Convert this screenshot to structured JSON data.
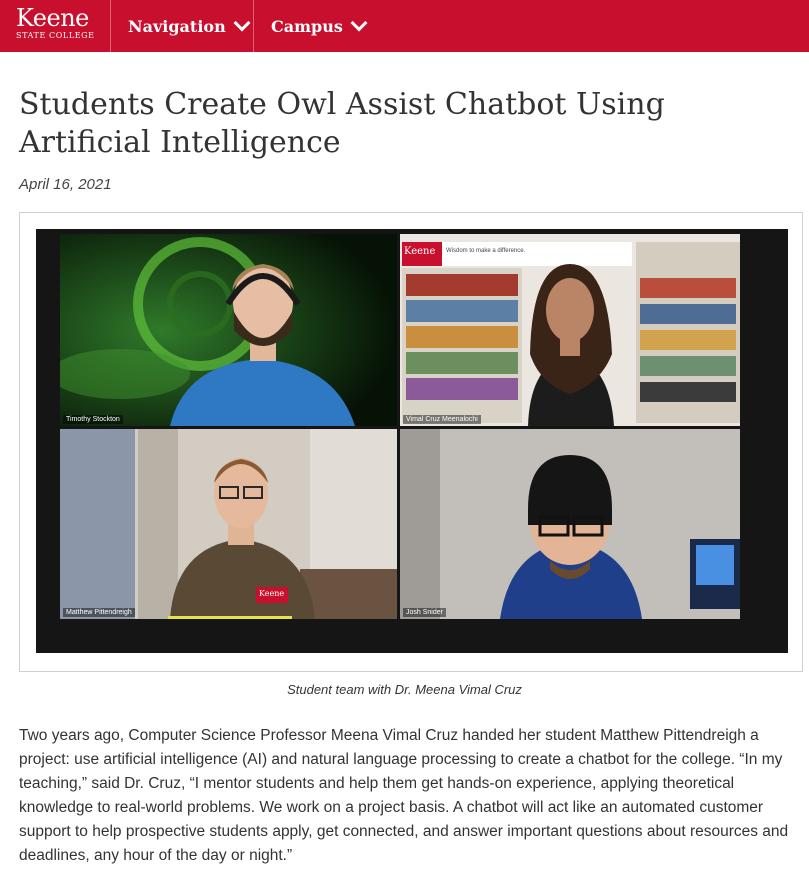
{
  "header": {
    "logo_text": "Keene",
    "logo_subtext": "STATE COLLEGE",
    "nav": [
      {
        "label": "Navigation"
      },
      {
        "label": "Campus"
      }
    ],
    "brand_color": "#c8102e"
  },
  "article": {
    "title": "Students Create Owl Assist Chatbot Using Artificial Intelligence",
    "date": "April 16, 2021",
    "image": {
      "participants": [
        {
          "name": "Timothy Stockton"
        },
        {
          "name": "Vimal Cruz Meenalochi"
        },
        {
          "name": "Matthew Pittendreigh"
        },
        {
          "name": "Josh Snider"
        }
      ],
      "banner_logo": "Keene",
      "banner_tagline": "Wisdom to make a difference.",
      "shirt_logo": "Keene"
    },
    "caption": "Student team with Dr. Meena Vimal Cruz",
    "paragraph": "Two years ago, Computer Science Professor Meena Vimal Cruz handed her student Matthew Pittendreigh a project: use artificial intelligence (AI) and natural language processing to create a chatbot for the college. “In my teaching,” said Dr. Cruz, “I mentor students and help them get hands-on experience, applying theoretical knowledge to real-world problems. We work on a project basis. A chatbot will act like an automated customer support to help prospective students apply, get connected, and answer important questions about resources and deadlines, any hour of the day or night.”"
  }
}
